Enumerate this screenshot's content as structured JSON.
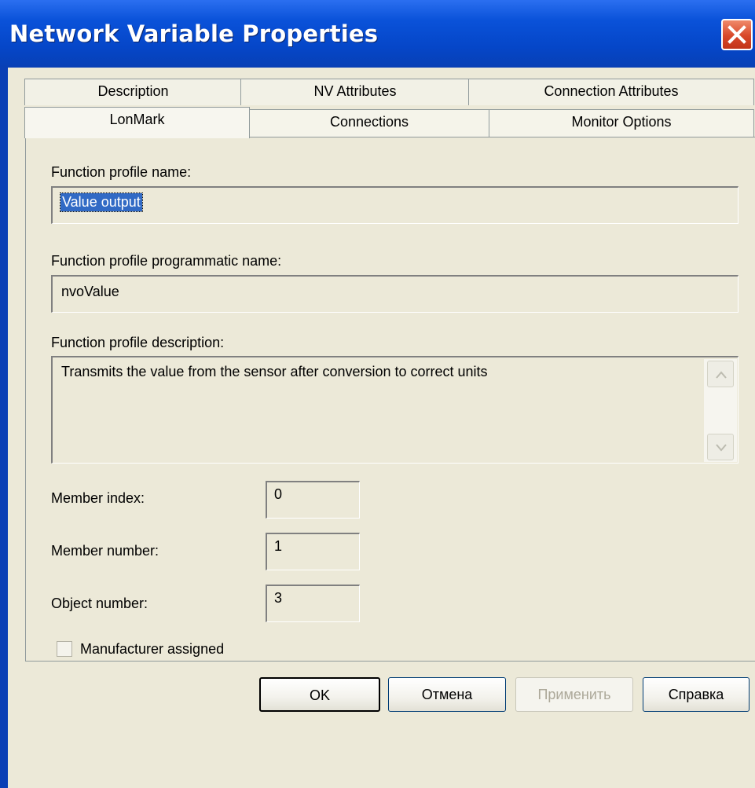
{
  "window": {
    "title": "Network Variable Properties"
  },
  "tabs": {
    "back_row": [
      "Description",
      "NV Attributes",
      "Connection Attributes"
    ],
    "front_row": [
      "LonMark",
      "Connections",
      "Monitor Options"
    ],
    "active": "LonMark"
  },
  "form": {
    "fp_name_label": "Function profile name:",
    "fp_name_value": "Value output",
    "fp_prog_label": "Function profile programmatic name:",
    "fp_prog_value": "nvoValue",
    "fp_desc_label": "Function profile description:",
    "fp_desc_value": "Transmits the value from the sensor after conversion to correct units",
    "member_index_label": "Member index:",
    "member_index_value": "0",
    "member_number_label": "Member number:",
    "member_number_value": "1",
    "object_number_label": "Object number:",
    "object_number_value": "3",
    "manufacturer_label": "Manufacturer assigned",
    "manufacturer_checked": false
  },
  "buttons": {
    "ok": "OK",
    "cancel": "Отмена",
    "apply": "Применить",
    "help": "Справка"
  },
  "colors": {
    "titlebar": "#0a52d9",
    "selection": "#316ac5",
    "face": "#ece9d8"
  }
}
